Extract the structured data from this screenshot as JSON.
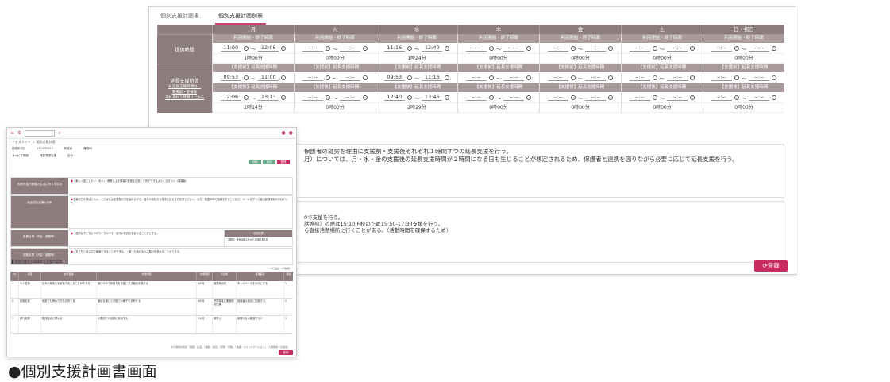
{
  "caption": "●個別支援計画書画面",
  "back": {
    "tabs": [
      "個別支援計画書",
      "個別支援計画別表"
    ],
    "days": [
      "月",
      "火",
      "水",
      "木",
      "金",
      "土",
      "日・祝日"
    ],
    "provide": {
      "label": "提供時間",
      "header": "利用開始・終了時間",
      "times": [
        [
          "11:00",
          "12:06"
        ],
        [
          "--:--",
          "--:--"
        ],
        [
          "11:16",
          "12:40"
        ],
        [
          "--:--",
          "--:--"
        ],
        [
          "--:--",
          "--:--"
        ],
        [
          "--:--",
          "--:--"
        ],
        [
          "--:--",
          "--:--"
        ]
      ],
      "durations": [
        "1時06分",
        "0時00分",
        "1時24分",
        "0時00分",
        "0時00分",
        "0時00分",
        "0時00分"
      ]
    },
    "extend": {
      "label": "延長支援時間",
      "sub1": "※ 延長支援時間は、",
      "sub2": "支援前・支援後",
      "sub3": "それぞれ１時間以上から",
      "before_header": "【支援前】延長支援時間",
      "after_header": "【支援後】延長支援時間",
      "before_times": [
        [
          "09:53",
          "11:00"
        ],
        [
          "--:--",
          "--:--"
        ],
        [
          "09:53",
          "11:16"
        ],
        [
          "--:--",
          "--:--"
        ],
        [
          "--:--",
          "--:--"
        ],
        [
          "--:--",
          "--:--"
        ],
        [
          "--:--",
          "--:--"
        ]
      ],
      "after_times": [
        [
          "12:06",
          "13:13"
        ],
        [
          "--:--",
          "--:--"
        ],
        [
          "12:40",
          "13:46"
        ],
        [
          "--:--",
          "--:--"
        ],
        [
          "--:--",
          "--:--"
        ],
        [
          "--:--",
          "--:--"
        ],
        [
          "--:--",
          "--:--"
        ]
      ],
      "durations": [
        "2時14分",
        "0時00分",
        "2時29分",
        "0時00分",
        "0時00分",
        "0時00分",
        "0時00分"
      ]
    },
    "notes1": [
      "保護者の就労を理由に支援前・支援後それぞれ１時間ずつの延長支援を行う。",
      "月）については、月・水・金の支援後の延長支援時間が２時間になる日も生じることが想定されるため、保護者と連携を図りながら必要に応じて延長支援を行う。"
    ],
    "notes2": [
      "0で支援を行う。",
      "話等部）の際は15:10下校のため15:50-17:30支援を行う。",
      "ら直接活動場所に行くことがある。（活動時間を確保するため）"
    ],
    "register": "登録"
  },
  "front": {
    "crumb": "アセスメント ＞ 個別支援計画",
    "fields": [
      "作成年月日",
      "2024/04/27",
      "作成者",
      "確認印",
      "サービス種別",
      "区分",
      "児童発達支援"
    ],
    "btns": [
      "印刷",
      "保存",
      "登録"
    ],
    "grid": [
      {
        "label": "利用児及び家族の生活に対する意向",
        "text": "・楽しく過ごしたい（本人）・療育による発達の促進を目指して何ができるようになりたい（保護者）"
      },
      {
        "label": "総合的な支援の方針",
        "text": "言葉の力を伸ばしたい。ことばによる表現の力を高めながら、自分の気持ちを相手に伝える力を育てていく。また、集団の中で順番を守ることなど、ルールを守って遊ぶ経験を積み重ねていく。"
      },
      {
        "label": "長期目標（内容・期間等）",
        "text": "一般的な子どもとのやりとりの中で、自分の気持ちを伝えることができる。",
        "side_h": "長期目標",
        "side_b": "（期間）令和6年4月から令和7年3月"
      },
      {
        "label": "短期目標（内容・期間等）",
        "text": "・友だちと遊ぶ中で順番を守ることができる。・困った時に大人に助けを求めることができる。"
      }
    ],
    "section": "支援目標及び具体的な支援内容等",
    "controls": "＋行追加  －行削除",
    "table_headers": [
      "No",
      "項目",
      "支援目標",
      "支援内容",
      "達成時期",
      "担当者",
      "留意事項",
      "優先"
    ],
    "rows": [
      [
        "1",
        "本人支援",
        "自分の気持ちを言葉で伝えることができる",
        "遊びの中で気持ちを言葉にする機会を設ける",
        "6か月",
        "児童指導員",
        "本人のペースを大切にする",
        "1"
      ],
      [
        "2",
        "家族支援",
        "家庭でも関わり方を共有する",
        "面談を通じて家庭での様子を共有する",
        "6か月",
        "児童発達支援管理責任者",
        "保護者の負担に配慮する",
        "2"
      ],
      [
        "3",
        "移行支援",
        "集団生活に慣れる",
        "小集団での活動に参加する",
        "6か月",
        "保育士",
        "無理のない範囲で行う",
        "3"
      ]
    ],
    "footer": "※５領域の視点「健康・生活」「運動・感覚」「認知・行動」「言語・コミュニケーション」「人間関係・社会性」",
    "register": "登録"
  }
}
